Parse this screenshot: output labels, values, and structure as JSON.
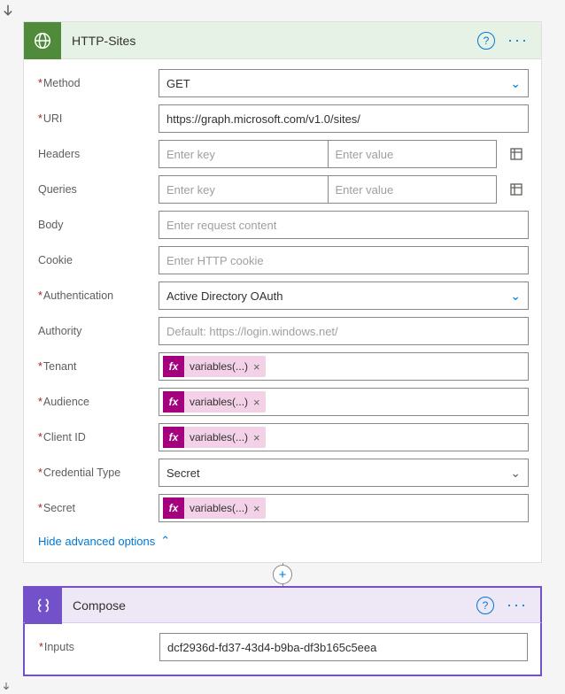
{
  "httpSites": {
    "title": "HTTP-Sites",
    "method": {
      "label": "Method",
      "value": "GET"
    },
    "uri": {
      "label": "URI",
      "value": "https://graph.microsoft.com/v1.0/sites/"
    },
    "headers": {
      "label": "Headers",
      "keyPh": "Enter key",
      "valPh": "Enter value"
    },
    "queries": {
      "label": "Queries",
      "keyPh": "Enter key",
      "valPh": "Enter value"
    },
    "body": {
      "label": "Body",
      "ph": "Enter request content"
    },
    "cookie": {
      "label": "Cookie",
      "ph": "Enter HTTP cookie"
    },
    "auth": {
      "label": "Authentication",
      "value": "Active Directory OAuth"
    },
    "authority": {
      "label": "Authority",
      "ph": "Default: https://login.windows.net/"
    },
    "tenant": {
      "label": "Tenant",
      "token": "variables(...)"
    },
    "audience": {
      "label": "Audience",
      "token": "variables(...)"
    },
    "clientId": {
      "label": "Client ID",
      "token": "variables(...)"
    },
    "credType": {
      "label": "Credential Type",
      "value": "Secret"
    },
    "secret": {
      "label": "Secret",
      "token": "variables(...)"
    },
    "advLink": "Hide advanced options",
    "fx": "fx"
  },
  "compose": {
    "title": "Compose",
    "inputs": {
      "label": "Inputs",
      "value": "dcf2936d-fd37-43d4-b9ba-df3b165c5eea"
    }
  }
}
